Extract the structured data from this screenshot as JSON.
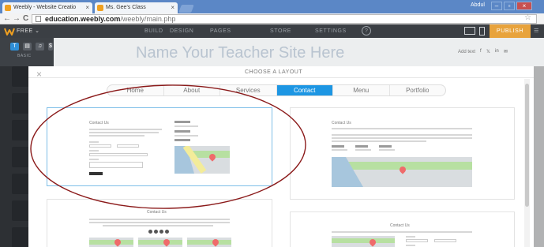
{
  "browser": {
    "tabs": [
      {
        "title": "Weebly - Website Creatio"
      },
      {
        "title": "Ms. Gee's Class"
      }
    ],
    "window_user": "Abdul",
    "url_host": "education.weebly.com",
    "url_path": "/weebly/main.php"
  },
  "weebly_bar": {
    "plan": "FREE",
    "nav": [
      "BUILD",
      "DESIGN",
      "PAGES",
      "STORE",
      "SETTINGS"
    ],
    "help": "?",
    "publish": "PUBLISH"
  },
  "sidebar": {
    "icons": [
      "T",
      "▤",
      "♫",
      "$",
      "⋯"
    ],
    "section_label": "BASIC"
  },
  "editor": {
    "site_title": "Name Your Teacher Site Here",
    "add_text": "Add text",
    "social": [
      "f",
      "𝕏",
      "in",
      "✉"
    ]
  },
  "modal": {
    "title": "CHOOSE A LAYOUT",
    "close": "×",
    "tabs": [
      {
        "label": "Home",
        "active": false
      },
      {
        "label": "About",
        "active": false
      },
      {
        "label": "Services",
        "active": false
      },
      {
        "label": "Contact",
        "active": true
      },
      {
        "label": "Menu",
        "active": false
      },
      {
        "label": "Portfolio",
        "active": false
      }
    ],
    "cards": [
      {
        "heading": "Contact Us"
      },
      {
        "heading": "Contact Us"
      },
      {
        "heading": "Contact Us"
      },
      {
        "heading": "Contact Us"
      }
    ]
  },
  "colors": {
    "accent_blue": "#1d96e3",
    "publish_orange": "#e8a33c",
    "annotation_red": "#8b1a1a"
  }
}
